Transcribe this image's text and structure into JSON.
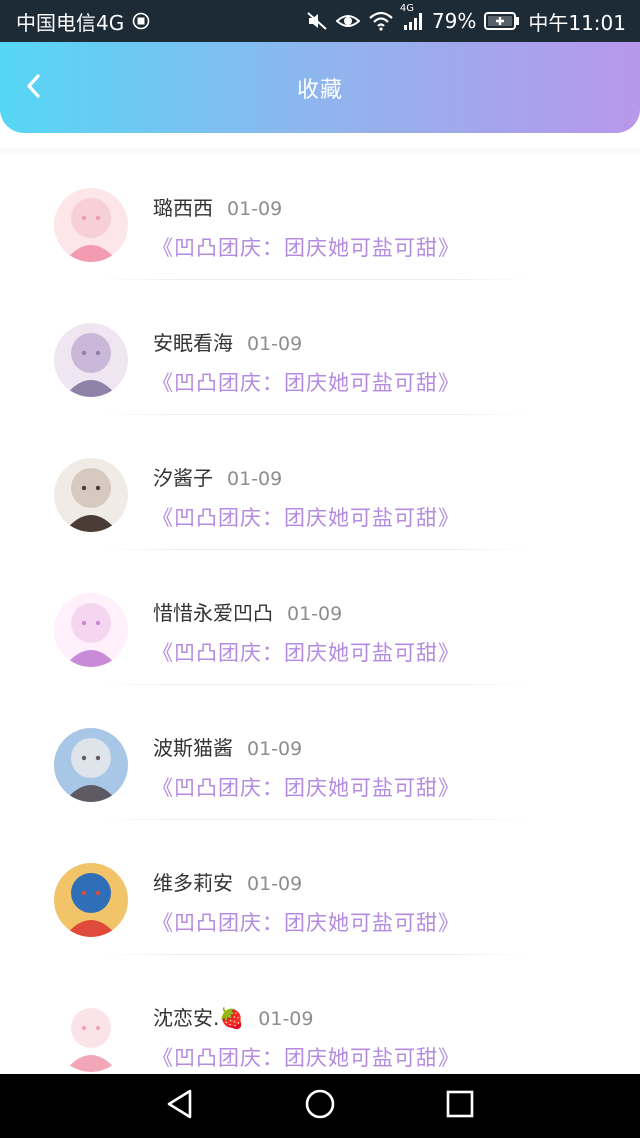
{
  "status_bar": {
    "carrier": "中国电信4G",
    "battery_percent": "79%",
    "time": "中午11:01",
    "network_label": "4G",
    "icons": [
      "sim-icon",
      "mute-icon",
      "eye-icon",
      "wifi-icon",
      "signal-icon",
      "battery-icon"
    ]
  },
  "header": {
    "title": "收藏",
    "back_icon": "chevron-left-icon"
  },
  "favorites": [
    {
      "name": "璐西西",
      "date": "01-09",
      "title": "《凹凸团庆：团庆她可盐可甜》",
      "avatar_colors": [
        "#f7cfd6",
        "#f39bb0",
        "#fde6e9"
      ]
    },
    {
      "name": "安眠看海",
      "date": "01-09",
      "title": "《凹凸团庆：团庆她可盐可甜》",
      "avatar_colors": [
        "#c9b8d8",
        "#8f82a8",
        "#efe6f2"
      ]
    },
    {
      "name": "汐酱子",
      "date": "01-09",
      "title": "《凹凸团庆：团庆她可盐可甜》",
      "avatar_colors": [
        "#d7c9c0",
        "#4a3b35",
        "#f1ebe6"
      ]
    },
    {
      "name": "惜惜永爱凹凸",
      "date": "01-09",
      "title": "《凹凸团庆：团庆她可盐可甜》",
      "avatar_colors": [
        "#f5d6f0",
        "#c98ad8",
        "#fff0fb"
      ]
    },
    {
      "name": "波斯猫酱",
      "date": "01-09",
      "title": "《凹凸团庆：团庆她可盐可甜》",
      "avatar_colors": [
        "#dfe3ea",
        "#5e5a63",
        "#a8c7e6"
      ]
    },
    {
      "name": "维多莉安",
      "date": "01-09",
      "title": "《凹凸团庆：团庆她可盐可甜》",
      "avatar_colors": [
        "#2f6fb8",
        "#e04a3a",
        "#f2c46a"
      ]
    },
    {
      "name": "沈恋安.🍓",
      "date": "01-09",
      "title": "《凹凸团庆：团庆她可盐可甜》",
      "avatar_colors": [
        "#fbe3ea",
        "#f2a7b9",
        "#ffffff"
      ]
    }
  ],
  "nav_bar": {
    "buttons": [
      "back-triangle-icon",
      "home-circle-icon",
      "recents-square-icon"
    ]
  }
}
